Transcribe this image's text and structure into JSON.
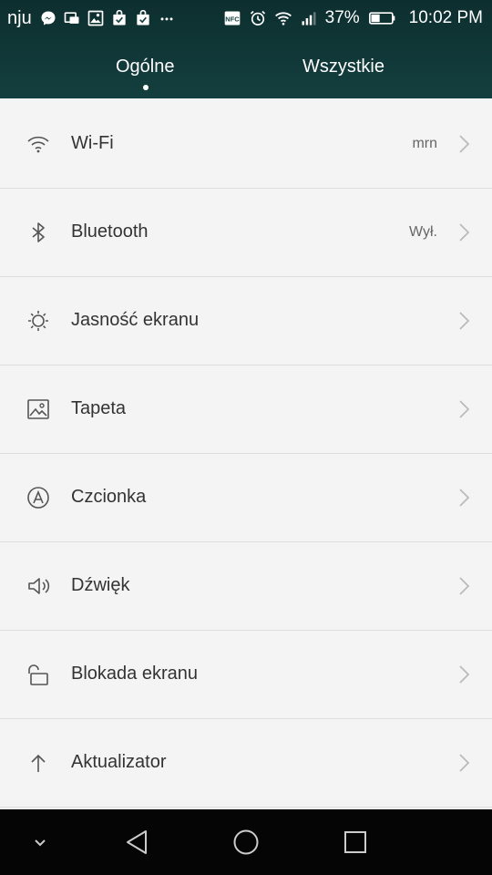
{
  "status_bar": {
    "carrier": "nju",
    "battery_percent": "37%",
    "time": "10:02 PM",
    "icons_left": [
      "messenger-icon",
      "image-notification-icon",
      "gallery-icon",
      "shopping-bag-icon",
      "shopping-bag-icon",
      "more-notifications-icon"
    ],
    "icons_right": [
      "nfc-icon",
      "alarm-icon",
      "wifi-icon",
      "signal-icon",
      "battery-icon"
    ]
  },
  "tabs": {
    "general": "Ogólne",
    "all": "Wszystkie",
    "active": "general"
  },
  "settings": [
    {
      "label": "Wi-Fi",
      "value": "mrn",
      "icon": "wifi-icon"
    },
    {
      "label": "Bluetooth",
      "value": "Wył.",
      "icon": "bluetooth-icon"
    },
    {
      "label": "Jasność ekranu",
      "value": "",
      "icon": "brightness-icon"
    },
    {
      "label": "Tapeta",
      "value": "",
      "icon": "wallpaper-icon"
    },
    {
      "label": "Czcionka",
      "value": "",
      "icon": "font-icon"
    },
    {
      "label": "Dźwięk",
      "value": "",
      "icon": "sound-icon"
    },
    {
      "label": "Blokada ekranu",
      "value": "",
      "icon": "lock-icon"
    },
    {
      "label": "Aktualizator",
      "value": "",
      "icon": "update-arrow-icon"
    }
  ],
  "navigation": [
    "hide-keyboard-icon",
    "back-icon",
    "home-icon",
    "recent-apps-icon"
  ],
  "colors": {
    "header": "#0d2e2e",
    "background": "#f4f4f4",
    "navbar": "#050505",
    "text": "#333333"
  }
}
